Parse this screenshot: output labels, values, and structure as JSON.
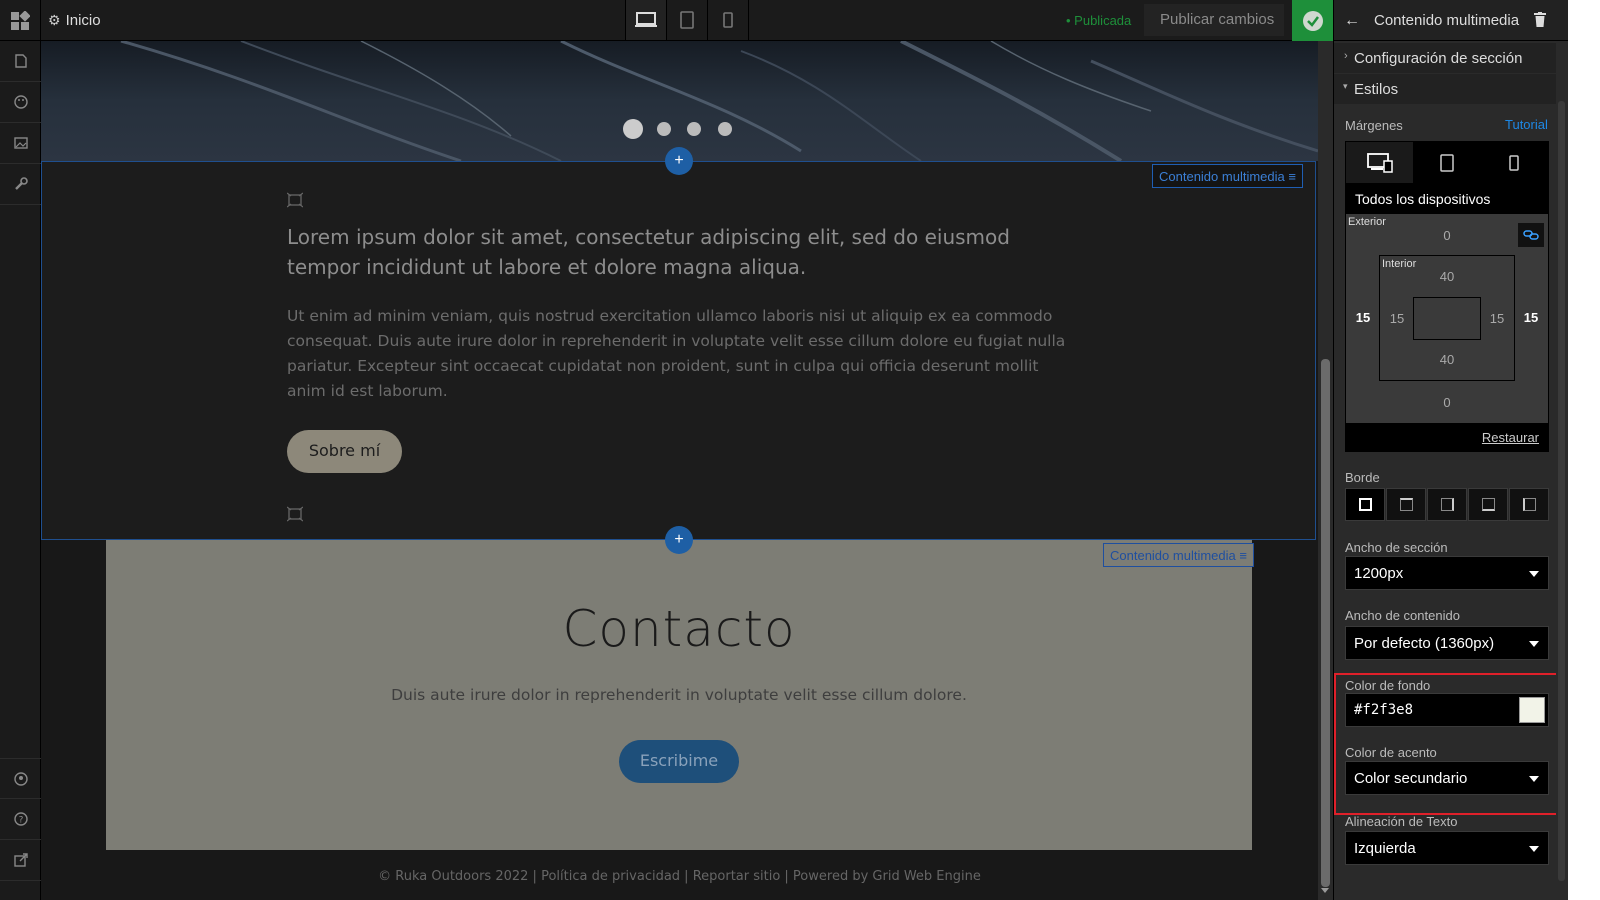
{
  "topbar": {
    "home_label": "Inicio",
    "status_label": "• Publicada",
    "publish_button": "Publicar cambios"
  },
  "canvas": {
    "media_tag_label": "Contenido multimedia",
    "about": {
      "heading": "Lorem ipsum dolor sit amet, consectetur adipiscing elit, sed do eiusmod tempor incididunt ut labore et dolore magna aliqua.",
      "body": "Ut enim ad minim veniam, quis nostrud exercitation ullamco laboris nisi ut aliquip ex ea commodo consequat. Duis aute irure dolor in reprehenderit in voluptate velit esse cillum dolore eu fugiat nulla pariatur. Excepteur sint occaecat cupidatat non proident, sunt in culpa qui officia deserunt mollit anim id est laborum.",
      "button": "Sobre mí"
    },
    "contact": {
      "title": "Contacto",
      "text": "Duis aute irure dolor in reprehenderit in voluptate velit esse cillum dolore.",
      "button": "Escribime"
    },
    "footer": "© Ruka Outdoors 2022 | Política de privacidad | Reportar sitio | Powered by Grid Web Engine"
  },
  "panel": {
    "title": "Contenido multimedia",
    "section_config": "Configuración de sección",
    "styles": "Estilos",
    "margins_label": "Márgenes",
    "tutorial_link": "Tutorial",
    "all_devices": "Todos los dispositivos",
    "exterior_label": "Exterior",
    "interior_label": "Interior",
    "exterior": {
      "top": "0",
      "bottom": "0",
      "left": "15",
      "right": "15"
    },
    "interior": {
      "top": "40",
      "bottom": "40",
      "left": "15",
      "right": "15"
    },
    "restore_link": "Restaurar",
    "border_label": "Borde",
    "section_width_label": "Ancho de sección",
    "section_width_value": "1200px",
    "content_width_label": "Ancho de contenido",
    "content_width_value": "Por defecto (1360px)",
    "bg_color_label": "Color de fondo",
    "bg_color_value": "#f2f3e8",
    "accent_label": "Color de acento",
    "accent_value": "Color secundario",
    "text_align_label": "Alineación de Texto",
    "text_align_value": "Izquierda"
  },
  "colors": {
    "accent_blue": "#1e5fa5",
    "publish_green": "#1e8f3a",
    "highlight_red": "#e0202a",
    "contact_bg": "#7d7d75",
    "swatch": "#f2f3e8"
  },
  "icons": [
    "grid-logo-icon",
    "gear-icon",
    "desktop-icon",
    "tablet-icon",
    "mobile-icon",
    "check-icon",
    "back-arrow-icon",
    "trash-icon",
    "page-icon",
    "palette-icon",
    "image-icon",
    "wrench-icon",
    "user-circle-icon",
    "help-icon",
    "external-link-icon",
    "link-icon",
    "media-placeholder-icon"
  ]
}
